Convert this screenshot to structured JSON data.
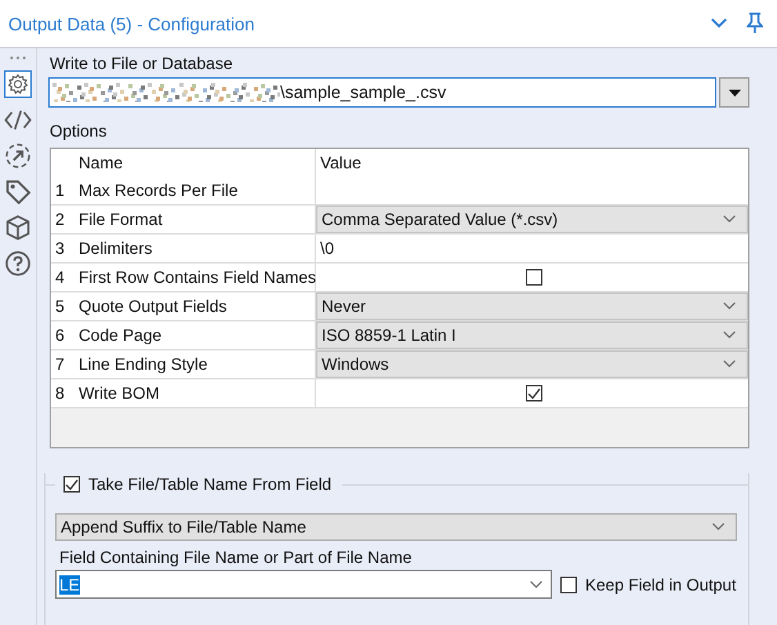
{
  "window": {
    "title": "Output Data (5) - Configuration"
  },
  "write_to": {
    "label": "Write to File or Database",
    "value": "\\sample_sample_.csv"
  },
  "options": {
    "label": "Options",
    "columns": [
      "Name",
      "Value"
    ],
    "rows": [
      {
        "number": "1",
        "name": "Max Records Per File",
        "kind": "text",
        "value": ""
      },
      {
        "number": "2",
        "name": "File Format",
        "kind": "dropdown",
        "value": "Comma Separated Value (*.csv)"
      },
      {
        "number": "3",
        "name": "Delimiters",
        "kind": "text",
        "value": "\\0"
      },
      {
        "number": "4",
        "name": "First Row Contains Field Names",
        "kind": "checkbox",
        "checked": false
      },
      {
        "number": "5",
        "name": "Quote Output Fields",
        "kind": "dropdown",
        "value": "Never"
      },
      {
        "number": "6",
        "name": "Code Page",
        "kind": "dropdown",
        "value": "ISO 8859-1 Latin I"
      },
      {
        "number": "7",
        "name": "Line Ending Style",
        "kind": "dropdown",
        "value": "Windows"
      },
      {
        "number": "8",
        "name": "Write BOM",
        "kind": "checkbox",
        "checked": true
      }
    ]
  },
  "take_name": {
    "label": "Take File/Table Name From Field",
    "checked": true,
    "mode": "Append Suffix to File/Table Name",
    "field_label": "Field Containing File Name or Part of File Name",
    "field_value": "LE",
    "keep_field": {
      "label": "Keep Field in Output",
      "checked": false
    }
  }
}
